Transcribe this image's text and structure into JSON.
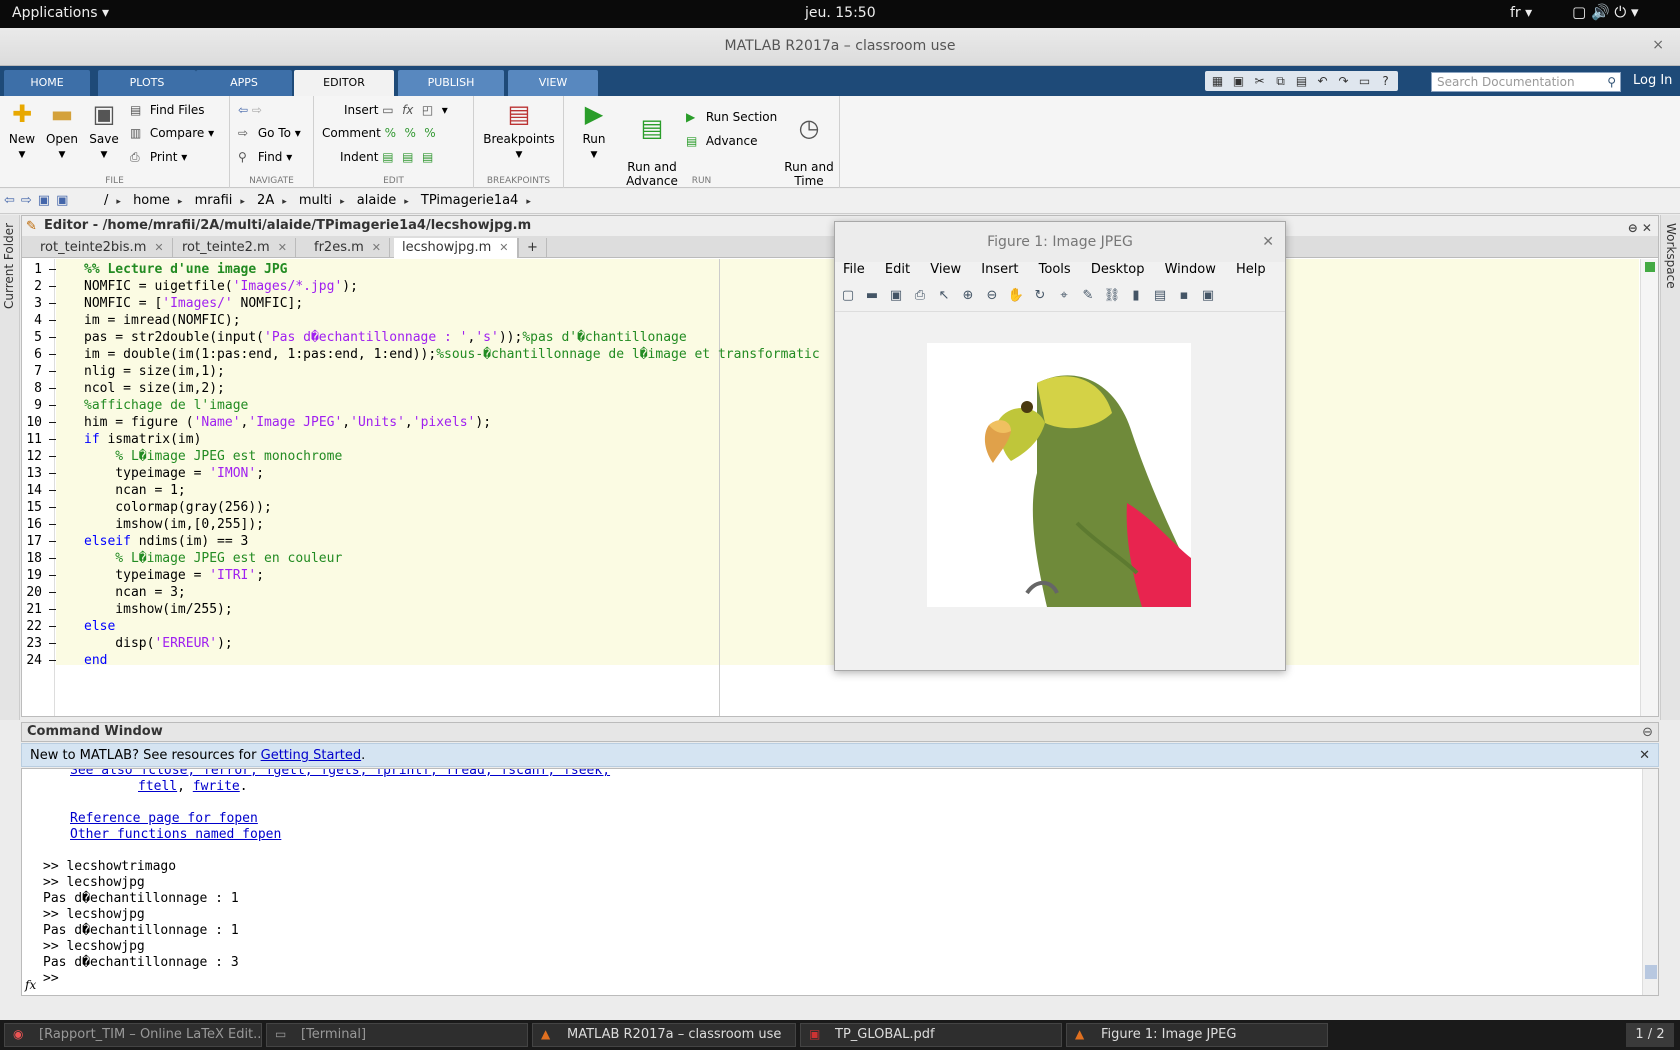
{
  "topbar": {
    "applications": "Applications ▾",
    "clock": "jeu. 15:50",
    "lang": "fr ▾",
    "status_icons": "▢ 🔊 ⏻ ▾"
  },
  "window": {
    "title": "MATLAB R2017a – classroom use",
    "close": "×"
  },
  "ribbon_tabs": [
    "HOME",
    "PLOTS",
    "APPS",
    "EDITOR",
    "PUBLISH",
    "VIEW"
  ],
  "search": {
    "placeholder": "Search Documentation"
  },
  "login": "Log In",
  "ribbon": {
    "file": {
      "label": "FILE",
      "new": "New",
      "open": "Open",
      "save": "Save",
      "find_files": "Find Files",
      "compare": "Compare",
      "print": "Print"
    },
    "navigate": {
      "label": "NAVIGATE",
      "goto": "Go To",
      "find": "Find"
    },
    "edit": {
      "label": "EDIT",
      "insert": "Insert",
      "comment": "Comment",
      "indent": "Indent"
    },
    "breakpoints": {
      "label": "BREAKPOINTS",
      "breakpoints": "Breakpoints"
    },
    "run": {
      "label": "RUN",
      "run": "Run",
      "run_advance": "Run and\nAdvance",
      "run_section": "Run Section",
      "advance": "Advance",
      "run_time": "Run and\nTime"
    }
  },
  "path": [
    "/",
    "home",
    "mrafii",
    "2A",
    "multi",
    "alaide",
    "TPimagerie1a4"
  ],
  "side": {
    "left": "Current Folder",
    "right": "Workspace"
  },
  "editor": {
    "title": "Editor - /home/mrafii/2A/multi/alaide/TPimagerie1a4/lecshowjpg.m",
    "tabs": [
      "rot_teinte2bis.m",
      "rot_teinte2.m",
      "fr2es.m",
      "lecshowjpg.m"
    ],
    "code": [
      [
        [
          "cb",
          "%% Lecture d'une image JPG"
        ]
      ],
      [
        [
          "",
          "NOMFIC = uigetfile("
        ],
        [
          "s",
          "'Images/*.jpg'"
        ],
        [
          "",
          ");"
        ]
      ],
      [
        [
          "",
          "NOMFIC = ["
        ],
        [
          "s",
          "'Images/'"
        ],
        [
          "",
          " NOMFIC];"
        ]
      ],
      [
        [
          "",
          "im = imread(NOMFIC);"
        ]
      ],
      [
        [
          "",
          "pas = str2double(input("
        ],
        [
          "s",
          "'Pas d�echantillonnage : '"
        ],
        [
          "",
          ","
        ],
        [
          "s",
          "'s'"
        ],
        [
          "",
          "));"
        ],
        [
          "c",
          "%pas d'�chantillonage"
        ]
      ],
      [
        [
          "",
          "im = double(im(1:pas:end, 1:pas:end, 1:end));"
        ],
        [
          "c",
          "%sous-�chantillonnage de l�image et transformatic"
        ]
      ],
      [
        [
          "",
          "nlig = size(im,1);"
        ]
      ],
      [
        [
          "",
          "ncol = size(im,2);"
        ]
      ],
      [
        [
          "c",
          "%affichage de l'image"
        ]
      ],
      [
        [
          "",
          "him = figure ("
        ],
        [
          "s",
          "'Name'"
        ],
        [
          "",
          ","
        ],
        [
          "s",
          "'Image JPEG'"
        ],
        [
          "",
          ","
        ],
        [
          "s",
          "'Units'"
        ],
        [
          "",
          ","
        ],
        [
          "s",
          "'pixels'"
        ],
        [
          "",
          ");"
        ]
      ],
      [
        [
          "k",
          "if"
        ],
        [
          "",
          " ismatrix(im)"
        ]
      ],
      [
        [
          "c",
          "    % L�image JPEG est monochrome"
        ]
      ],
      [
        [
          "",
          "    typeimage = "
        ],
        [
          "s",
          "'IMON'"
        ],
        [
          "",
          ";"
        ]
      ],
      [
        [
          "",
          "    ncan = 1;"
        ]
      ],
      [
        [
          "",
          "    colormap(gray(256));"
        ]
      ],
      [
        [
          "",
          "    imshow(im,[0,255]);"
        ]
      ],
      [
        [
          "k",
          "elseif"
        ],
        [
          "",
          " ndims(im) == 3"
        ]
      ],
      [
        [
          "c",
          "    % L�image JPEG est en couleur"
        ]
      ],
      [
        [
          "",
          "    typeimage = "
        ],
        [
          "s",
          "'ITRI'"
        ],
        [
          "",
          ";"
        ]
      ],
      [
        [
          "",
          "    ncan = 3;"
        ]
      ],
      [
        [
          "",
          "    imshow(im/255);"
        ]
      ],
      [
        [
          "k",
          "else"
        ]
      ],
      [
        [
          "",
          "    disp("
        ],
        [
          "s",
          "'ERREUR'"
        ],
        [
          "",
          ");"
        ]
      ],
      [
        [
          "k",
          "end"
        ]
      ]
    ]
  },
  "figure": {
    "title": "Figure 1: Image JPEG",
    "menu": [
      "File",
      "Edit",
      "View",
      "Insert",
      "Tools",
      "Desktop",
      "Window",
      "Help"
    ]
  },
  "command": {
    "title": "Command Window",
    "new_text": "New to MATLAB? See resources for ",
    "new_link": "Getting Started",
    "new_end": ".",
    "see_also": "See also fclose, ferror, fgetl, fgets, fprintf, fread, fscanf, fseek,",
    "ftell": "ftell",
    "fwrite": "fwrite",
    "ref_link": "Reference page for fopen",
    "other_link": "Other functions named fopen",
    "lines": [
      ">> lecshowtrimago",
      ">> lecshowjpg",
      "Pas d�echantillonnage : 1",
      ">> lecshowjpg",
      "Pas d�echantillonnage : 1",
      ">> lecshowjpg",
      "Pas d�echantillonnage : 3"
    ],
    "prompt": ">>",
    "fx": "fx"
  },
  "taskbar": {
    "items": [
      "[Rapport_TIM – Online LaTeX Edit...",
      "[Terminal]",
      "MATLAB R2017a – classroom use",
      "TP_GLOBAL.pdf",
      "Figure 1: Image JPEG"
    ],
    "pager": "1 / 2"
  }
}
